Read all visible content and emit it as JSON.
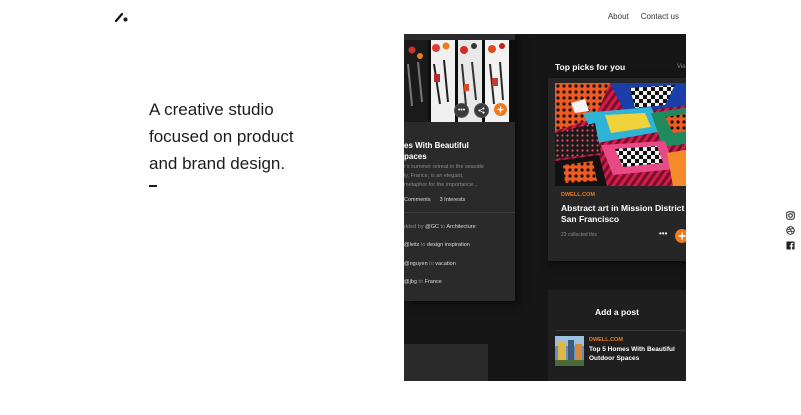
{
  "header": {
    "nav": [
      {
        "label": "About"
      },
      {
        "label": "Contact us"
      }
    ]
  },
  "hero": {
    "lines": [
      "A creative studio",
      "focused on product",
      "and brand design."
    ]
  },
  "social": {
    "icons": [
      "instagram-icon",
      "dribbble-icon",
      "facebook-icon"
    ]
  },
  "mockup": {
    "left_card": {
      "title_lines": [
        "es With Beautiful",
        "paces"
      ],
      "desc_lines": [
        "r's summer retreat in the seaside",
        "ly, France, is an elegant,",
        "metaphor for the importance..."
      ],
      "comments": "Comments",
      "interests": "3 Interests",
      "activity": [
        {
          "a": "dded by",
          "b": "@GC",
          "c": "to",
          "d": "Architecture"
        },
        {
          "b": "@leitz",
          "c": "to",
          "d": "design inspiration"
        },
        {
          "b": "@nguyen",
          "c": "to",
          "d": "vacation"
        },
        {
          "b": "@jbg",
          "c": "to",
          "d": "France"
        }
      ]
    },
    "right": {
      "section_title": "Top picks for you",
      "view_all": "Vie",
      "card": {
        "source": "DWELL.COM",
        "title": "Abstract art in Mission District San Francisco",
        "meta": "23 collected this"
      },
      "add_post": {
        "label": "Add a post",
        "source": "DWELL.COM",
        "title": "Top 5 Homes With Beautiful Outdoor Spaces"
      }
    },
    "colors": {
      "accent": "#ef7a1c",
      "panel": "#161616",
      "card": "#2a2a2a"
    }
  }
}
